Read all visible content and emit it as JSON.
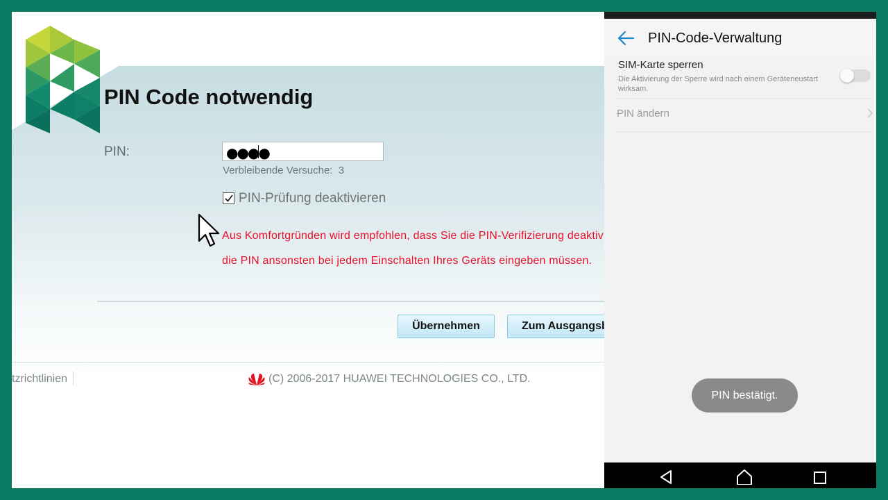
{
  "web": {
    "title": "PIN Code notwendig",
    "pin_label": "PIN:",
    "pin_value": "●●●●",
    "tries_label": "Verbleibende Versuche:",
    "tries_count": "3",
    "checkbox_label": "PIN-Prüfung deaktivieren",
    "checkbox_checked": true,
    "warning_line1": "Aus Komfortgründen wird empfohlen, dass Sie die PIN-Verifizierung deaktivi",
    "warning_line2": "die PIN ansonsten bei jedem Einschalten Ihres Geräts eingeben müssen.",
    "apply_label": "Übernehmen",
    "reset_label": "Zum Ausgangsb",
    "footer_link": "tzrichtlinien",
    "copyright": "(C) 2006-2017 HUAWEI TECHNOLOGIES CO., LTD.",
    "colors": {
      "warning": "#e8102a",
      "button": "#bfe7f6",
      "frame": "#0b7a63"
    }
  },
  "phone": {
    "title": "PIN-Code-Verwaltung",
    "sim_lock_title": "SIM-Karte sperren",
    "sim_lock_desc": "Die Aktivierung der Sperre wird nach einem Geräteneustart wirksam.",
    "sim_lock_on": false,
    "change_pin": "PIN ändern",
    "toast": "PIN bestätigt.",
    "colors": {
      "accent": "#1e88c8"
    }
  }
}
